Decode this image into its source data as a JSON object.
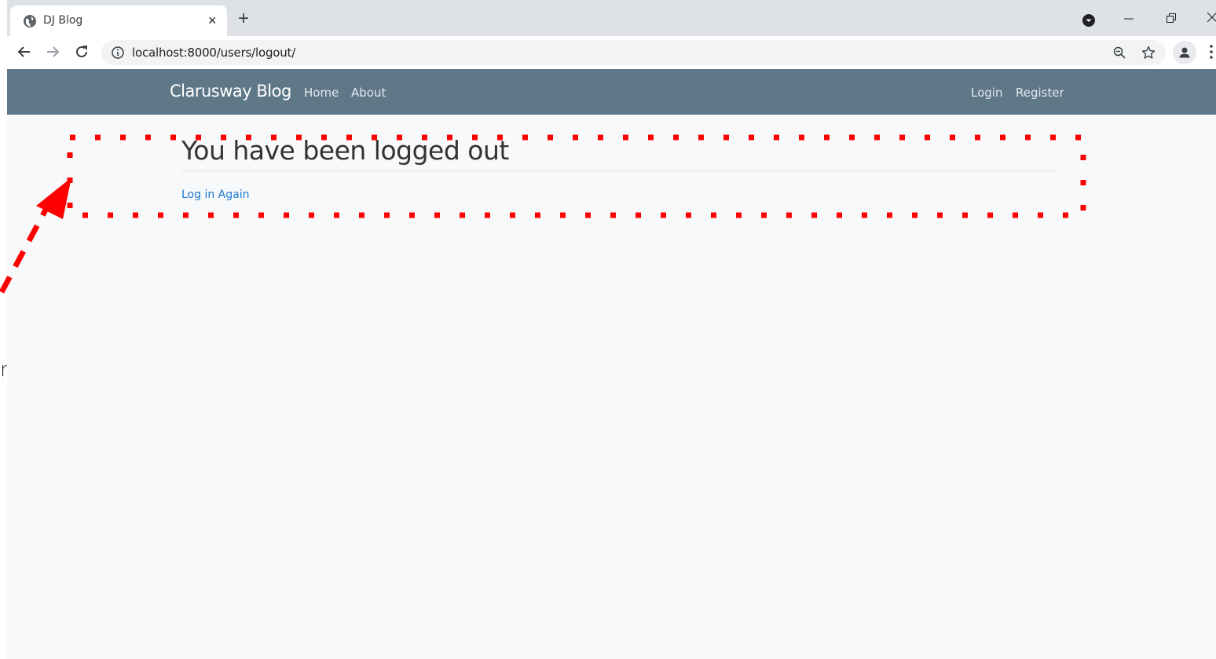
{
  "browser": {
    "tab_title": "DJ Blog",
    "tab_close": "×",
    "new_tab": "+",
    "url": "localhost:8000/users/logout/",
    "icons": [
      "globe-icon",
      "back-icon",
      "forward-icon",
      "reload-icon",
      "info-icon",
      "zoom-icon",
      "star-icon",
      "profile-icon",
      "menu-icon",
      "minimize-icon",
      "restore-icon",
      "close-icon"
    ]
  },
  "navbar": {
    "brand": "Clarusway Blog",
    "links": [
      "Home",
      "About"
    ],
    "right_links": [
      "Login",
      "Register"
    ],
    "color": "#5f7888"
  },
  "main": {
    "heading": "You have been logged out",
    "link": "Log in Again",
    "link_color": "#1b76d2"
  },
  "side_text": "n",
  "annotation": {
    "color": "#ff0000"
  }
}
